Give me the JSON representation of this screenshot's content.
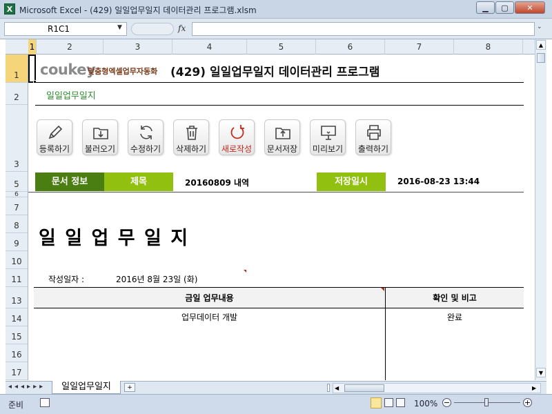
{
  "window": {
    "title": "Microsoft Excel - (429) 일일업무일지 데이터관리 프로그램.xlsm",
    "app_icon": "excel-icon"
  },
  "formula_bar": {
    "name_box": "R1C1",
    "fx_label": "fx",
    "formula": ""
  },
  "columns": [
    "1",
    "2",
    "3",
    "4",
    "5",
    "6",
    "7",
    "8"
  ],
  "rows": [
    "1",
    "2",
    "3",
    "5",
    "7",
    "8",
    "9",
    "10",
    "11",
    "13",
    "14",
    "15",
    "16",
    "17"
  ],
  "header": {
    "brand": "coukey",
    "brand_tagline": "맞춤형엑셀업무자동화",
    "program_title": "(429) 일일업무일지 데이터관리 프로그램",
    "sheet_subtitle": "일일업무일지"
  },
  "toolbar": [
    {
      "label": "등록하기",
      "icon": "pencil-icon"
    },
    {
      "label": "불러오기",
      "icon": "folder-download-icon"
    },
    {
      "label": "수정하기",
      "icon": "refresh-icon"
    },
    {
      "label": "삭제하기",
      "icon": "trash-icon"
    },
    {
      "label": "새로작성",
      "icon": "new-document-icon"
    },
    {
      "label": "문서저장",
      "icon": "folder-upload-icon"
    },
    {
      "label": "미리보기",
      "icon": "monitor-icon"
    },
    {
      "label": "출력하기",
      "icon": "printer-icon"
    }
  ],
  "doc_info": {
    "label": "문서 정보",
    "title_label": "제목",
    "title_value": "20160809 내역",
    "saved_label": "저장일시",
    "saved_value": "2016-08-23 13:44"
  },
  "journal": {
    "heading": "일 일 업 무 일 지",
    "date_label": "작성일자 :",
    "date_value": "2016년 8월 23일 (화)",
    "col_task": "금일 업무내용",
    "col_check": "확인 및 비고",
    "rows": [
      {
        "task": "업무데이터 개발",
        "check": "완료"
      }
    ]
  },
  "tabs": {
    "active": "일일업무일지"
  },
  "status": {
    "ready": "준비",
    "zoom": "100%"
  },
  "colors": {
    "dark_green": "#4a7d12",
    "light_green": "#92c010",
    "accent_red": "#c4281c",
    "subtitle_green": "#2e8b2e"
  }
}
